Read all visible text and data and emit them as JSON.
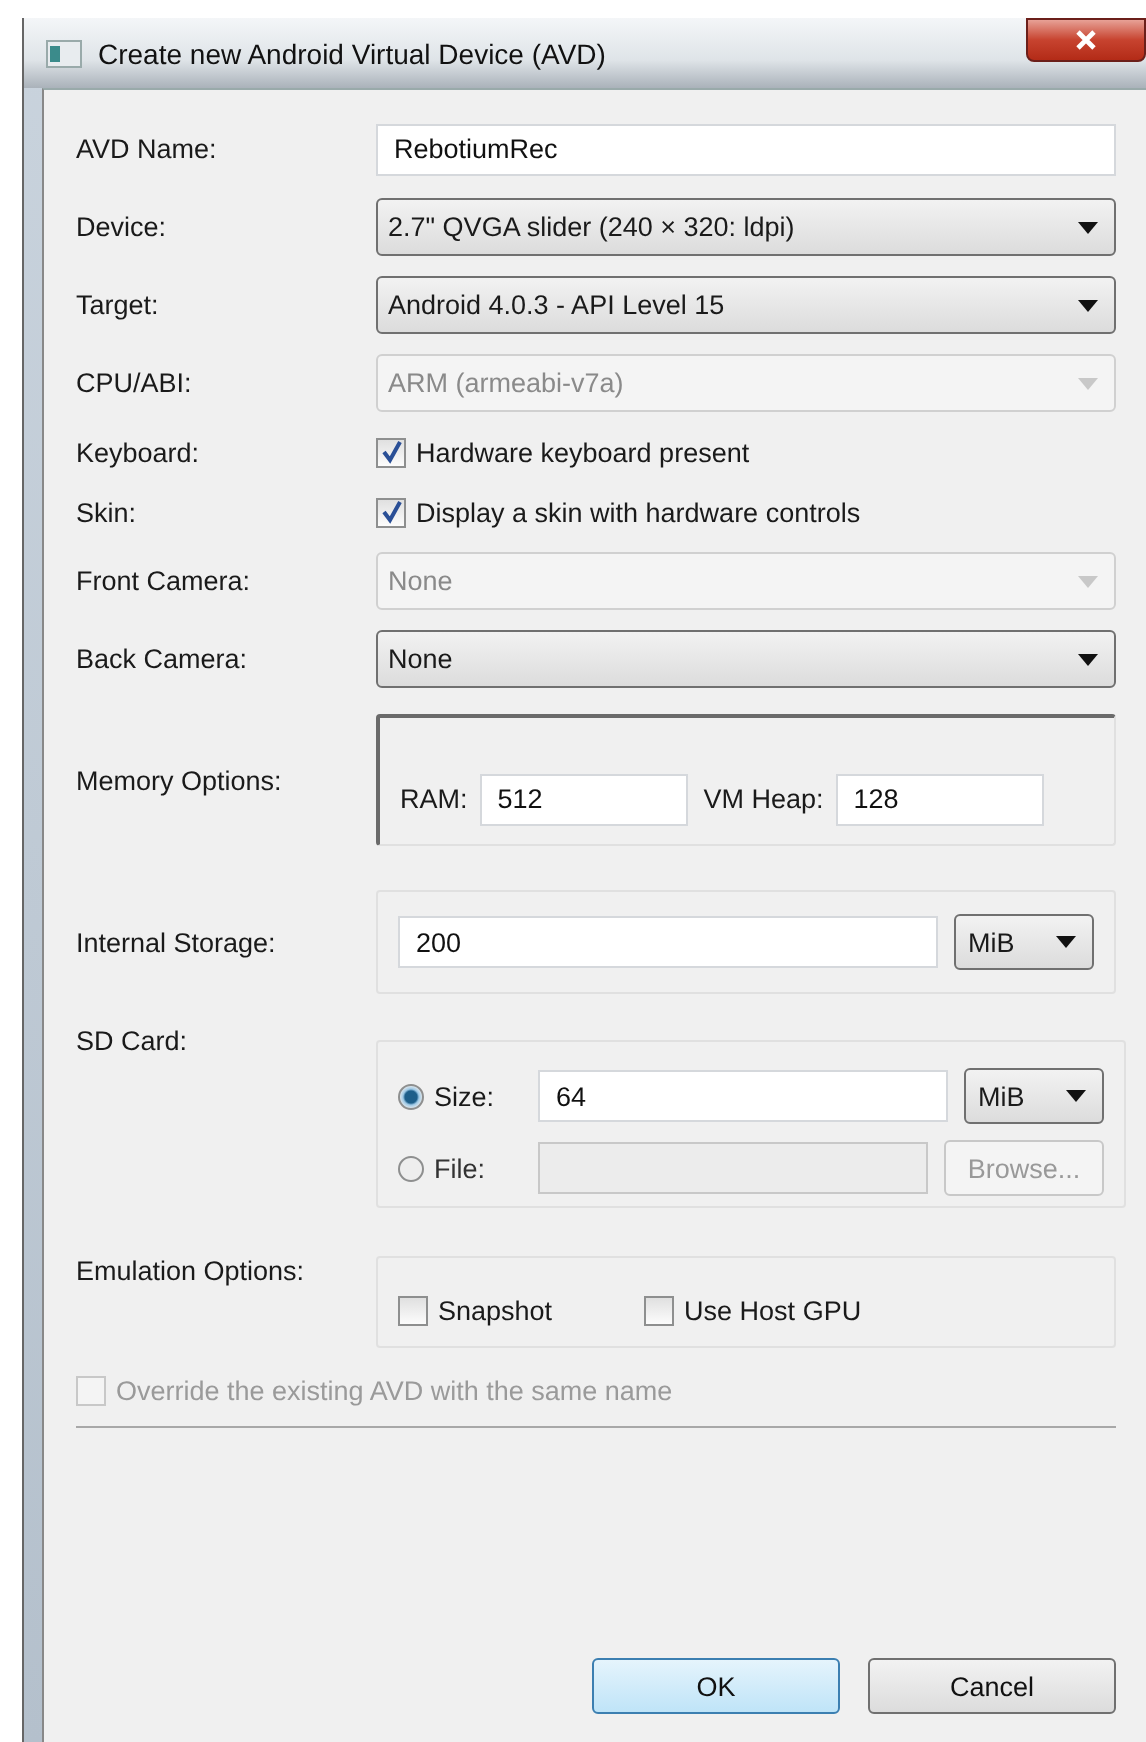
{
  "window": {
    "title": "Create new Android Virtual Device (AVD)"
  },
  "fields": [
    {
      "kind": "text",
      "label": "AVD Name:",
      "value": "RebotiumRec"
    },
    {
      "kind": "select",
      "label": "Device:",
      "value": "2.7\" QVGA slider (240 × 320: ldpi)",
      "disabled": false
    },
    {
      "kind": "select",
      "label": "Target:",
      "value": "Android 4.0.3 - API Level 15",
      "disabled": false
    },
    {
      "kind": "select",
      "label": "CPU/ABI:",
      "value": "ARM (armeabi-v7a)",
      "disabled": true
    },
    {
      "kind": "checkbox",
      "label": "Keyboard:",
      "text": "Hardware keyboard present",
      "checked": true
    },
    {
      "kind": "checkbox",
      "label": "Skin:",
      "text": "Display a skin with hardware controls",
      "checked": true
    },
    {
      "kind": "select",
      "label": "Front Camera:",
      "value": "None",
      "disabled": true
    },
    {
      "kind": "select",
      "label": "Back Camera:",
      "value": "None",
      "disabled": false
    }
  ],
  "memory": {
    "label": "Memory Options:",
    "ram_label": "RAM:",
    "ram": "512",
    "heap_label": "VM Heap:",
    "heap": "128"
  },
  "internal_storage": {
    "label": "Internal Storage:",
    "value": "200",
    "unit": "MiB"
  },
  "sd_card": {
    "label": "SD Card:",
    "options": [
      {
        "kind": "size",
        "label": "Size:",
        "selected": true,
        "value": "64",
        "unit": "MiB"
      },
      {
        "kind": "file",
        "label": "File:",
        "selected": false,
        "button": "Browse..."
      }
    ]
  },
  "emulation": {
    "label": "Emulation Options:",
    "options": [
      {
        "label": "Snapshot",
        "checked": false
      },
      {
        "label": "Use Host GPU",
        "checked": false
      }
    ]
  },
  "override": {
    "label": "Override the existing AVD with the same name",
    "checked": false,
    "disabled": true
  },
  "buttons": [
    {
      "label": "OK",
      "default": true
    },
    {
      "label": "Cancel",
      "default": false
    }
  ]
}
